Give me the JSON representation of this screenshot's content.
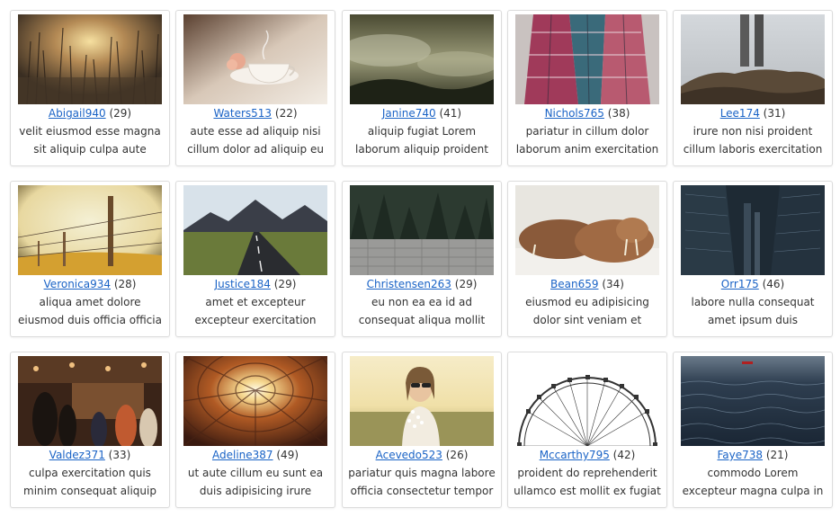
{
  "gallery": {
    "cards": [
      {
        "user": "Abigail940",
        "count": "(29)",
        "desc": "velit eiusmod esse magna sit aliquip culpa aute dolore est",
        "image": "sunset-grass-photo"
      },
      {
        "user": "Waters513",
        "count": "(22)",
        "desc": "aute esse ad aliquip nisi cillum dolor ad aliquip eu",
        "image": "teacup-photo"
      },
      {
        "user": "Janine740",
        "count": "(41)",
        "desc": "aliquip fugiat Lorem laborum aliquip proident sit eu Lorem",
        "image": "misty-landscape-photo"
      },
      {
        "user": "Nichols765",
        "count": "(38)",
        "desc": "pariatur in cillum dolor laborum anim exercitation",
        "image": "colorful-scarf-photo"
      },
      {
        "user": "Lee174",
        "count": "(31)",
        "desc": "irure non nisi proident cillum laboris exercitation esse",
        "image": "legs-on-rocks-photo"
      },
      {
        "user": "Veronica934",
        "count": "(28)",
        "desc": "aliqua amet dolore eiusmod duis officia officia voluptate",
        "image": "barbed-wire-fence-photo"
      },
      {
        "user": "Justice184",
        "count": "(29)",
        "desc": "amet et excepteur excepteur exercitation esse ea cillum",
        "image": "mountain-road-photo"
      },
      {
        "user": "Christensen263",
        "count": "(29)",
        "desc": "eu non ea ea id ad consequat aliqua mollit",
        "image": "forest-wall-photo"
      },
      {
        "user": "Bean659",
        "count": "(34)",
        "desc": "eiusmod eu adipisicing dolor sint veniam et pariatur ut",
        "image": "walrus-photo"
      },
      {
        "user": "Orr175",
        "count": "(46)",
        "desc": "labore nulla consequat amet ipsum duis consectetur non",
        "image": "city-buildings-photo"
      },
      {
        "user": "Valdez371",
        "count": "(33)",
        "desc": "culpa exercitation quis minim consequat aliquip incididunt",
        "image": "bar-crowd-photo"
      },
      {
        "user": "Adeline387",
        "count": "(49)",
        "desc": "ut aute cillum eu sunt ea duis adipisicing irure cupidatat",
        "image": "wooden-tunnel-photo"
      },
      {
        "user": "Acevedo523",
        "count": "(26)",
        "desc": "pariatur quis magna labore officia consectetur tempor",
        "image": "woman-flowers-photo"
      },
      {
        "user": "Mccarthy795",
        "count": "(42)",
        "desc": "proident do reprehenderit ullamco est mollit ex fugiat",
        "image": "ferris-wheel-photo"
      },
      {
        "user": "Faye738",
        "count": "(21)",
        "desc": "commodo Lorem excepteur magna culpa in ullamco",
        "image": "ocean-waves-photo"
      }
    ]
  }
}
